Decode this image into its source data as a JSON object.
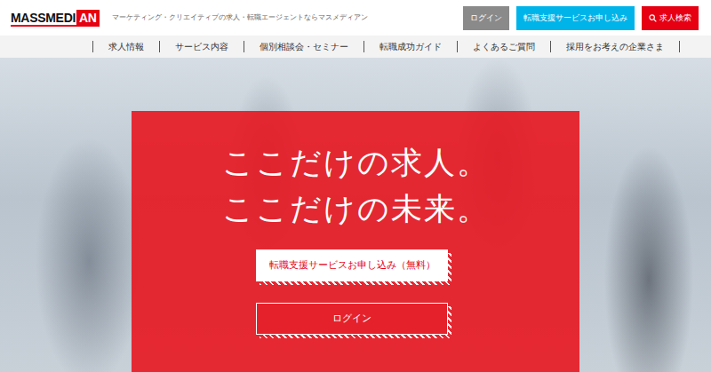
{
  "header": {
    "logo": {
      "main": "MASSMEDI",
      "accent": "AN"
    },
    "tagline": "マーケティング・クリエイティブの求人・転職エージェントならマスメディアン",
    "buttons": [
      {
        "label": "ログイン",
        "color": "#8a8a8a",
        "kind": "plain"
      },
      {
        "label": "転職支援サービスお申し込み",
        "color": "#00b4ea",
        "kind": "plain"
      },
      {
        "label": "求人検索",
        "color": "#e60012",
        "kind": "search"
      }
    ]
  },
  "nav": {
    "items": [
      "求人情報",
      "サービス内容",
      "個別相談会・セミナー",
      "転職成功ガイド",
      "よくあるご質問",
      "採用をお考えの企業さま"
    ]
  },
  "hero": {
    "headline": [
      "ここだけの求人。",
      "ここだけの未来。"
    ],
    "buttons": [
      {
        "label": "転職支援サービスお申し込み（無料）",
        "kind": "filled"
      },
      {
        "label": "ログイン",
        "kind": "outline"
      }
    ]
  }
}
